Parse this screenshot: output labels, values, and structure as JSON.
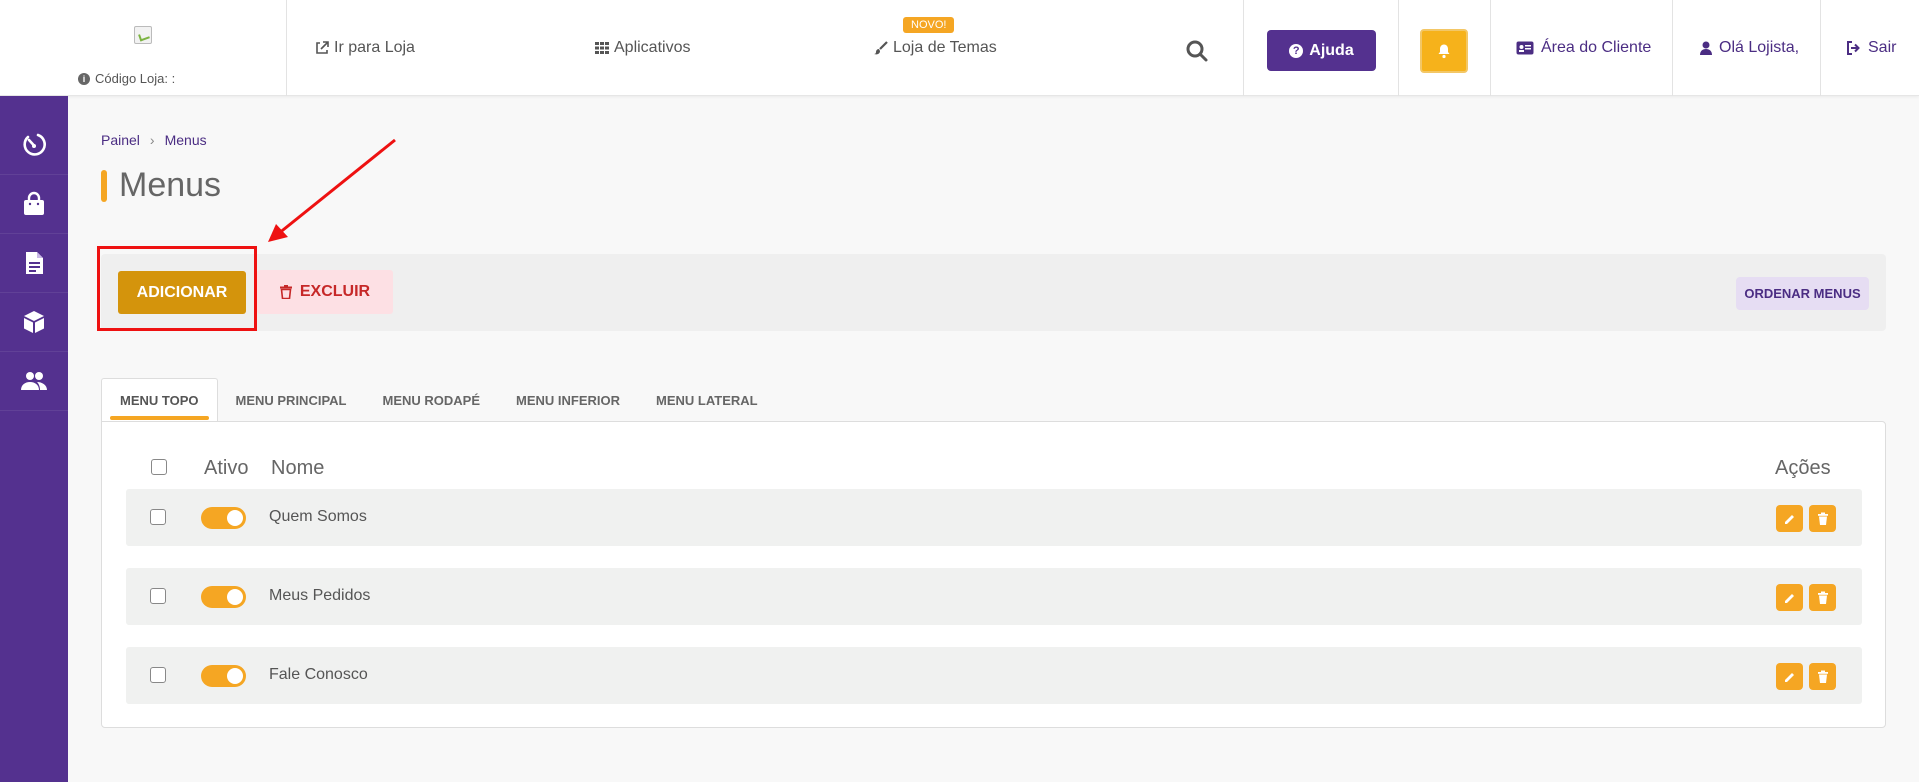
{
  "header": {
    "store_code_label": "Código Loja: :",
    "nav": {
      "go_store": "Ir para Loja",
      "apps": "Aplicativos",
      "themes": "Loja de Temas",
      "new_badge": "NOVO!"
    },
    "help_label": "Ajuda",
    "client_area": "Área do Cliente",
    "greeting": "Olá Lojista,",
    "logout": "Sair"
  },
  "breadcrumb": {
    "root": "Painel",
    "current": "Menus"
  },
  "page_title": "Menus",
  "actions": {
    "add_label": "ADICIONAR",
    "delete_label": "EXCLUIR",
    "order_label": "ORDENAR MENUS"
  },
  "tabs": [
    {
      "label": "MENU TOPO",
      "active": true
    },
    {
      "label": "MENU PRINCIPAL",
      "active": false
    },
    {
      "label": "MENU RODAPÉ",
      "active": false
    },
    {
      "label": "MENU INFERIOR",
      "active": false
    },
    {
      "label": "MENU LATERAL",
      "active": false
    }
  ],
  "table": {
    "headers": {
      "active": "Ativo",
      "name": "Nome",
      "actions": "Ações"
    },
    "rows": [
      {
        "name": "Quem Somos",
        "active": true
      },
      {
        "name": "Meus Pedidos",
        "active": true
      },
      {
        "name": "Fale Conosco",
        "active": true
      }
    ]
  },
  "colors": {
    "primary_purple": "#54318f",
    "accent_orange": "#f5a623",
    "add_button": "#d4940c",
    "delete_text": "#c62828",
    "annotation_red": "#e11111"
  },
  "icons": {
    "sidebar": [
      "dashboard-gauge-icon",
      "shopping-bag-icon",
      "document-icon",
      "box-icon",
      "users-icon"
    ]
  }
}
